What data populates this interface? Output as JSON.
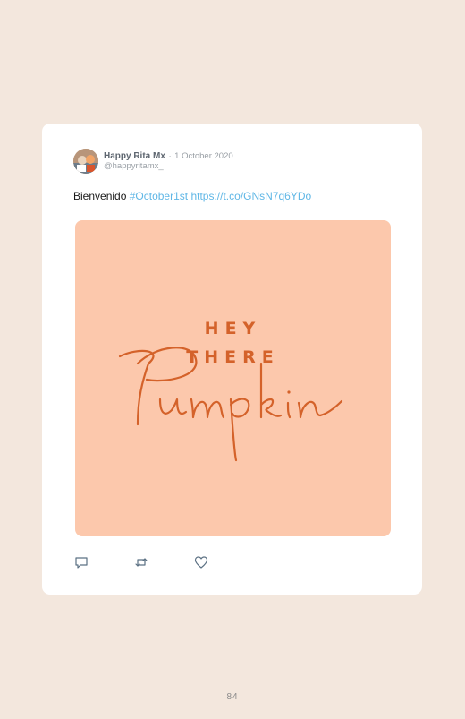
{
  "tweet": {
    "author_name": "Happy Rita Mx",
    "separator": "·",
    "date": "1 October 2020",
    "handle": "@happyritamx_",
    "text_prefix": "Bienvenido",
    "hashtag": "#October1st",
    "link": "https://t.co/GNsN7q6YDo",
    "image": {
      "line1": "HEY",
      "line2": "THERE",
      "script_word": "Pumpkin",
      "background_color": "#fcc8ac",
      "text_color": "#d4622a"
    },
    "actions": [
      {
        "icon": "reply-icon"
      },
      {
        "icon": "retweet-icon"
      },
      {
        "icon": "like-icon"
      }
    ]
  },
  "page": {
    "number": "84",
    "background_color": "#f3e7dd"
  },
  "colors": {
    "link": "#60b7e6",
    "name": "#5e6670",
    "muted": "#9aa0a6"
  }
}
